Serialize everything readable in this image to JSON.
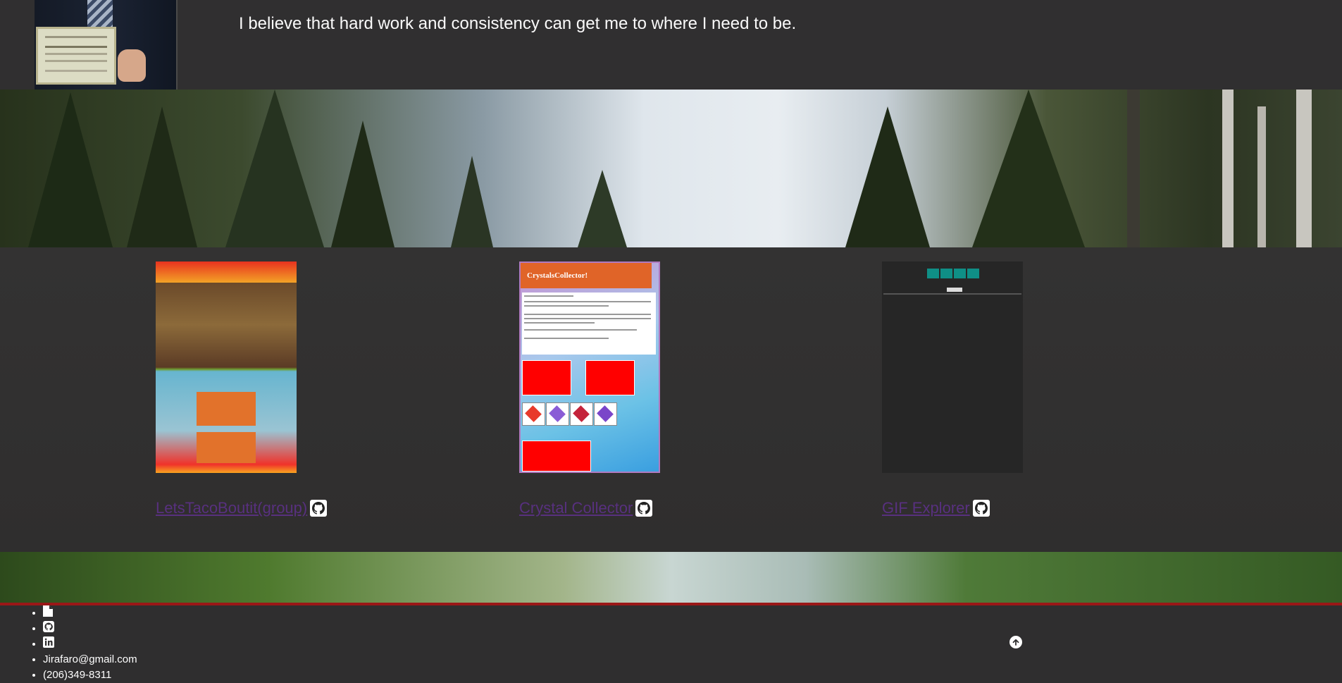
{
  "header": {
    "quote": "I believe that hard work and consistency can get me to where I need to be."
  },
  "projects": [
    {
      "title": "LetsTacoBoutit(group)",
      "github_icon": "github-icon"
    },
    {
      "title": "Crystal Collector",
      "github_icon": "github-icon"
    },
    {
      "title": "GIF Explorer",
      "github_icon": "github-icon"
    }
  ],
  "crystal_thumb": {
    "header_text": "CrystalsCollector!"
  },
  "footer": {
    "icons": [
      "file-icon",
      "github-icon",
      "linkedin-icon"
    ],
    "email": "Jirafaro@gmail.com",
    "phone": "(206)349-8311",
    "scroll_top_icon": "arrow-up-circle-icon"
  },
  "colors": {
    "background": "#2f2e2f",
    "link": "#58307f",
    "footer_border": "#9a1717"
  }
}
